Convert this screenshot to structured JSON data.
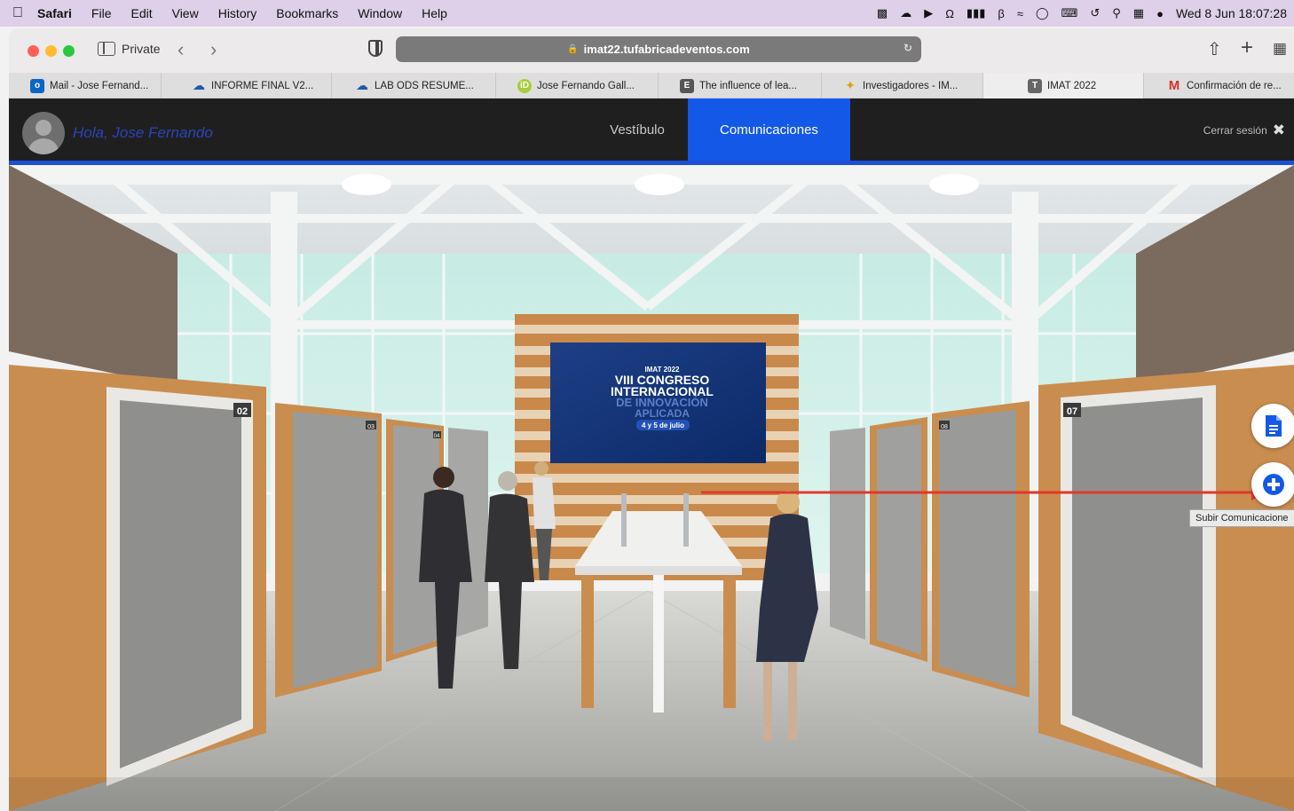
{
  "menubar": {
    "app": "Safari",
    "items": [
      "File",
      "Edit",
      "View",
      "History",
      "Bookmarks",
      "Window",
      "Help"
    ],
    "clock": "Wed 8 Jun  18:07:28"
  },
  "toolbar": {
    "private_label": "Private",
    "url": "imat22.tufabricadeventos.com"
  },
  "tabs": [
    {
      "label": "Mail - Jose Fernand...",
      "icon": "outlook-icon",
      "color": "#0a66c2"
    },
    {
      "label": "INFORME FINAL V2...",
      "icon": "onedrive-icon",
      "color": "#1e5aa8"
    },
    {
      "label": "LAB ODS RESUME...",
      "icon": "onedrive-icon",
      "color": "#1e5aa8"
    },
    {
      "label": "Jose Fernando Gall...",
      "icon": "orcid-icon",
      "color": "#a6ce39"
    },
    {
      "label": "The influence of lea...",
      "icon": "e-icon",
      "color": "#555555"
    },
    {
      "label": "Investigadores - IM...",
      "icon": "sparkle-icon",
      "color": "#e0a200"
    },
    {
      "label": "IMAT 2022",
      "icon": "t-icon",
      "color": "#666666"
    },
    {
      "label": "Confirmación de re...",
      "icon": "gmail-icon",
      "color": "#d93025"
    }
  ],
  "site": {
    "greeting": "Hola, Jose Fernando",
    "nav": [
      "Vestíbulo",
      "Comunicaciones"
    ],
    "logout": "Cerrar sesión"
  },
  "screen": {
    "line1": "IMAT 2022",
    "line2": "VIII CONGRESO",
    "line3": "INTERNACIONAL",
    "line4": "DE INNOVACIÓN",
    "line5": "APLICADA",
    "line6": "4 y 5 de julio"
  },
  "booths": {
    "left_main": "02",
    "left_2": "03",
    "left_3": "04",
    "right_main": "07",
    "right_2": "08"
  },
  "side_buttons": {
    "tooltip": "Subir Comunicacione"
  },
  "colors": {
    "accent": "#1458e8",
    "header_bg": "#1f1f1f",
    "arrow": "#e0392b"
  }
}
